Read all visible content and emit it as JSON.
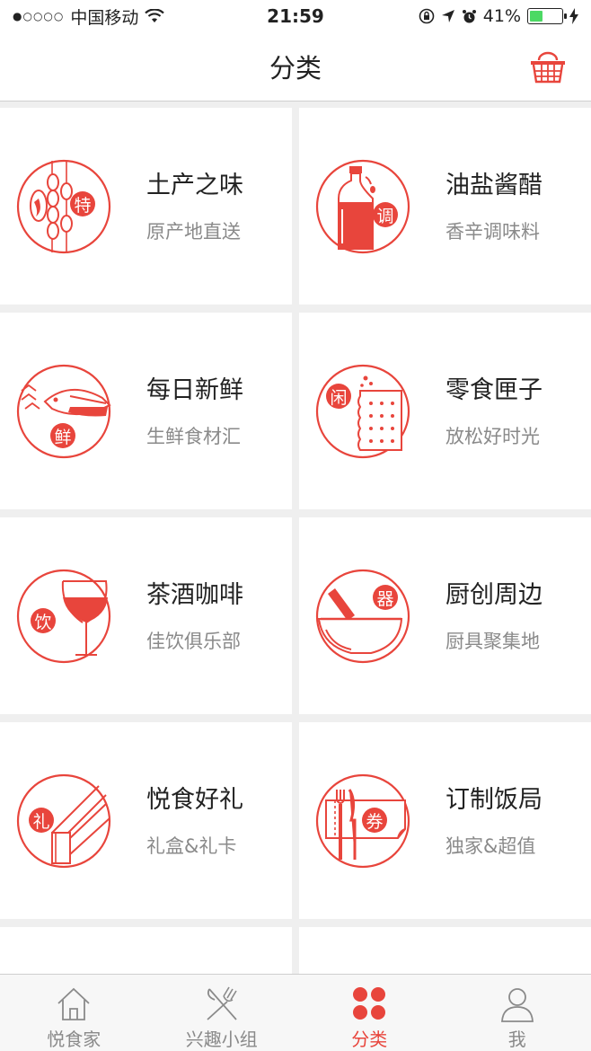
{
  "status_bar": {
    "signal": "●○○○○",
    "carrier": "中国移动",
    "time": "21:59",
    "battery_percent": "41%",
    "battery_level": 0.41,
    "battery_color": "#4cd964"
  },
  "nav": {
    "title": "分类",
    "right_icon": "basket-icon"
  },
  "accent_color": "#e8453c",
  "categories": [
    {
      "title": "土产之味",
      "subtitle": "原产地直送",
      "badge": "特",
      "icon": "local-produce-icon"
    },
    {
      "title": "油盐酱醋",
      "subtitle": "香辛调味料",
      "badge": "调",
      "icon": "seasoning-bottle-icon"
    },
    {
      "title": "每日新鲜",
      "subtitle": "生鲜食材汇",
      "badge": "鲜",
      "icon": "fish-icon"
    },
    {
      "title": "零食匣子",
      "subtitle": "放松好时光",
      "badge": "闲",
      "icon": "cracker-icon"
    },
    {
      "title": "茶酒咖啡",
      "subtitle": "佳饮俱乐部",
      "badge": "饮",
      "icon": "wine-glass-icon"
    },
    {
      "title": "厨创周边",
      "subtitle": "厨具聚集地",
      "badge": "器",
      "icon": "mortar-pestle-icon"
    },
    {
      "title": "悦食好礼",
      "subtitle": "礼盒&礼卡",
      "badge": "礼",
      "icon": "gift-box-icon"
    },
    {
      "title": "订制饭局",
      "subtitle": "独家&超值",
      "badge": "券",
      "icon": "dining-coupon-icon"
    }
  ],
  "tabs": [
    {
      "label": "悦食家",
      "icon": "home-icon",
      "active": false
    },
    {
      "label": "兴趣小组",
      "icon": "fork-knife-icon",
      "active": false
    },
    {
      "label": "分类",
      "icon": "category-dots-icon",
      "active": true
    },
    {
      "label": "我",
      "icon": "profile-icon",
      "active": false
    }
  ]
}
